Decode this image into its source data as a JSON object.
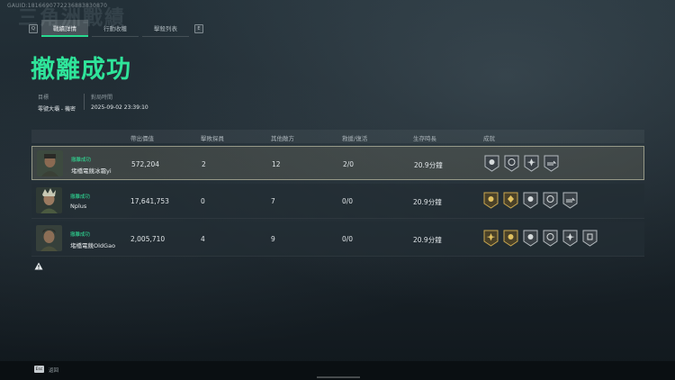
{
  "header": {
    "uid": "GAUID:1816690772236883830870",
    "watermark": "三角洲戰績"
  },
  "tabs": {
    "key_left": "Q",
    "key_right": "E",
    "items": [
      {
        "label": "戰績詳情",
        "active": true
      },
      {
        "label": "行動收穫",
        "active": false
      },
      {
        "label": "擊殺列表",
        "active": false
      }
    ]
  },
  "result_title": "撤離成功",
  "meta": {
    "target_label": "目標",
    "target_value": "零號大壩 - 機密",
    "time_label": "對局時間",
    "time_value": "2025-09-02 23:39:10"
  },
  "table": {
    "columns": [
      "帶出價值",
      "擊敗探員",
      "其他敵方",
      "救援/復活",
      "生存時長",
      "成就"
    ],
    "rows": [
      {
        "status": "撤離成功",
        "name": "堵橋電競冰霜yi",
        "value": "572,204",
        "kills": "2",
        "other": "12",
        "rescue": "2/0",
        "survival": "20.9分鐘",
        "badges": [
          "silver",
          "silver",
          "silver",
          "silver-wide"
        ],
        "self": true
      },
      {
        "status": "撤離成功",
        "name": "Nplus",
        "value": "17,641,753",
        "kills": "0",
        "other": "7",
        "rescue": "0/0",
        "survival": "20.9分鐘",
        "badges": [
          "gold",
          "gold",
          "silver",
          "silver",
          "silver-wide"
        ],
        "self": false
      },
      {
        "status": "撤離成功",
        "name": "堵橋電競OldGao",
        "value": "2,005,710",
        "kills": "4",
        "other": "9",
        "rescue": "0/0",
        "survival": "20.9分鐘",
        "badges": [
          "gold",
          "gold",
          "silver",
          "silver",
          "silver",
          "silver"
        ],
        "self": false
      }
    ]
  },
  "footer": {
    "esc_key": "Esc",
    "back_label": "返回"
  },
  "colors": {
    "accent": "#2fe49a",
    "gold": "#b89a4a",
    "silver": "#aeb5b9"
  }
}
